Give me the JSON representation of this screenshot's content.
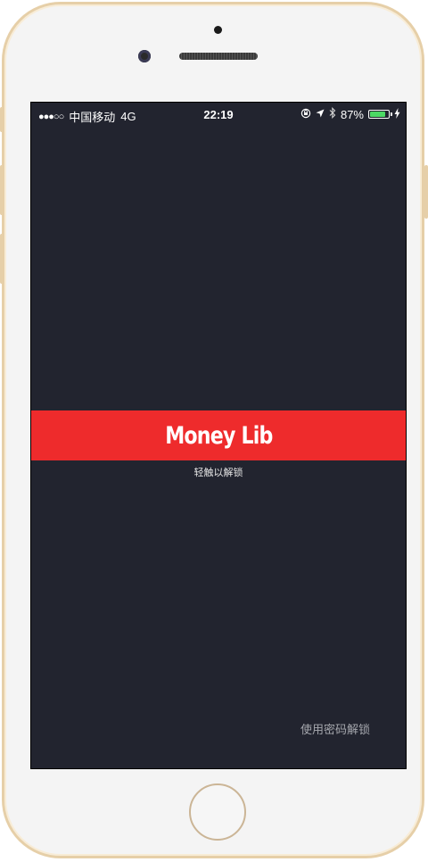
{
  "status_bar": {
    "signal_dots": "●●●○○",
    "carrier": "中国移动",
    "network": "4G",
    "time": "22:19",
    "lock_rotation_icon": "rotation-lock-icon",
    "location_icon": "location-arrow-icon",
    "bluetooth_icon": "bluetooth-icon",
    "battery_percent": "87%",
    "battery_level": 0.87,
    "charging_icon": "charging-bolt-icon"
  },
  "lock_screen": {
    "app_title": "Money Lib",
    "touch_hint": "轻触以解锁",
    "passcode_link": "使用密码解锁"
  },
  "colors": {
    "screen_background": "#22242f",
    "banner": "#ee2b2c",
    "battery_fill": "#4cd964",
    "phone_frame": "#e6cfa8"
  }
}
